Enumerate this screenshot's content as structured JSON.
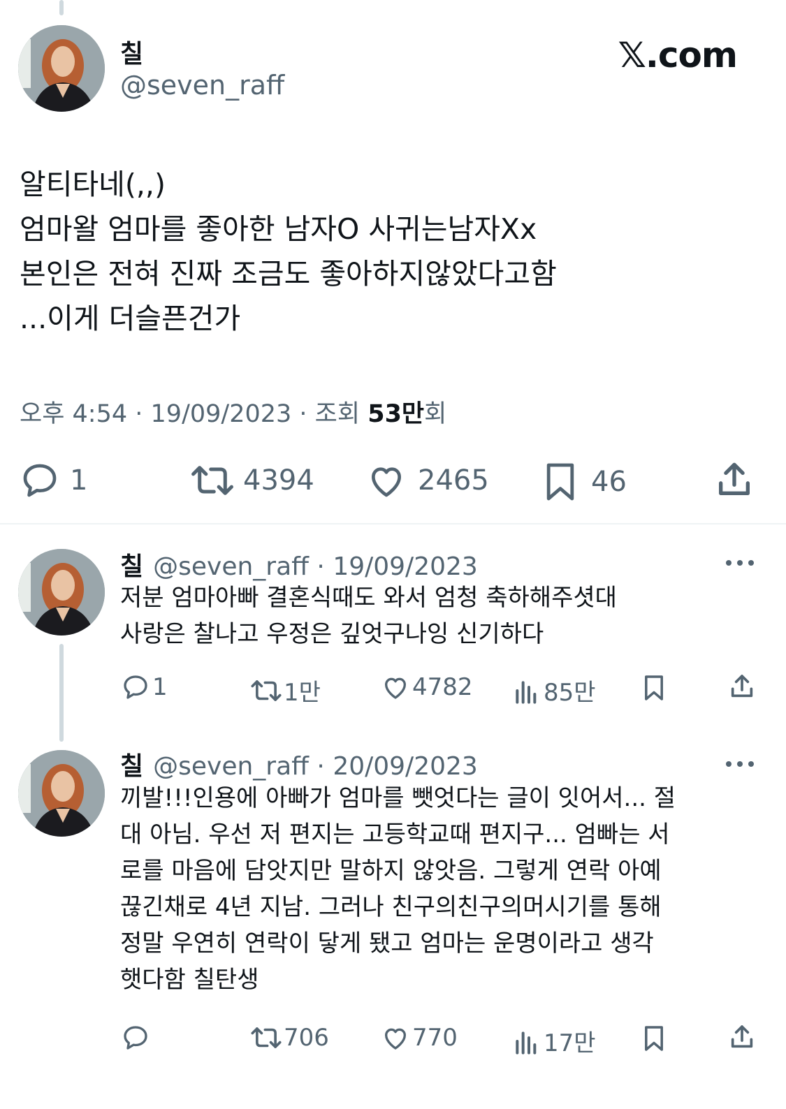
{
  "brand": "𝕏.com",
  "main_tweet": {
    "name": "칠",
    "handle": "@seven_raff",
    "lines": [
      "알티타네(,,)",
      "엄마왈 엄마를 좋아한 남자O 사귀는남자Xx",
      "본인은 전혀 진짜 조금도 좋아하지않았다고함",
      "...이게 더슬픈건가"
    ],
    "time": "오후 4:54",
    "date": "19/09/2023",
    "views_label": "조회",
    "views_count": "53만",
    "views_unit": "회",
    "replies": "1",
    "retweets": "4394",
    "likes": "2465",
    "bookmarks": "46"
  },
  "reply1": {
    "name": "칠",
    "handle": "@seven_raff",
    "date": "19/09/2023",
    "lines": [
      "저분 엄마아빠 결혼식때도 와서 엄청 축하해주셧대",
      "사랑은 찰나고 우정은 깊엇구나잉 신기하다"
    ],
    "replies": "1",
    "retweets": "1만",
    "likes": "4782",
    "views": "85만"
  },
  "reply2": {
    "name": "칠",
    "handle": "@seven_raff",
    "date": "20/09/2023",
    "lines": [
      "끼발!!!인용에 아빠가 엄마를 뺏엇다는 글이 잇어서... 절",
      "대 아님. 우선 저 편지는 고등학교때 편지구... 엄빠는 서",
      "로를 마음에 담앗지만 말하지 않앗음. 그렇게 연락 아예",
      "끊긴채로 4년 지남. 그러나 친구의친구의머시기를 통해",
      "정말 우연히 연락이 닿게 됐고 엄마는 운명이라고 생각",
      "햇다함 칠탄생"
    ],
    "replies": "",
    "retweets": "706",
    "likes": "770",
    "views": "17만"
  }
}
